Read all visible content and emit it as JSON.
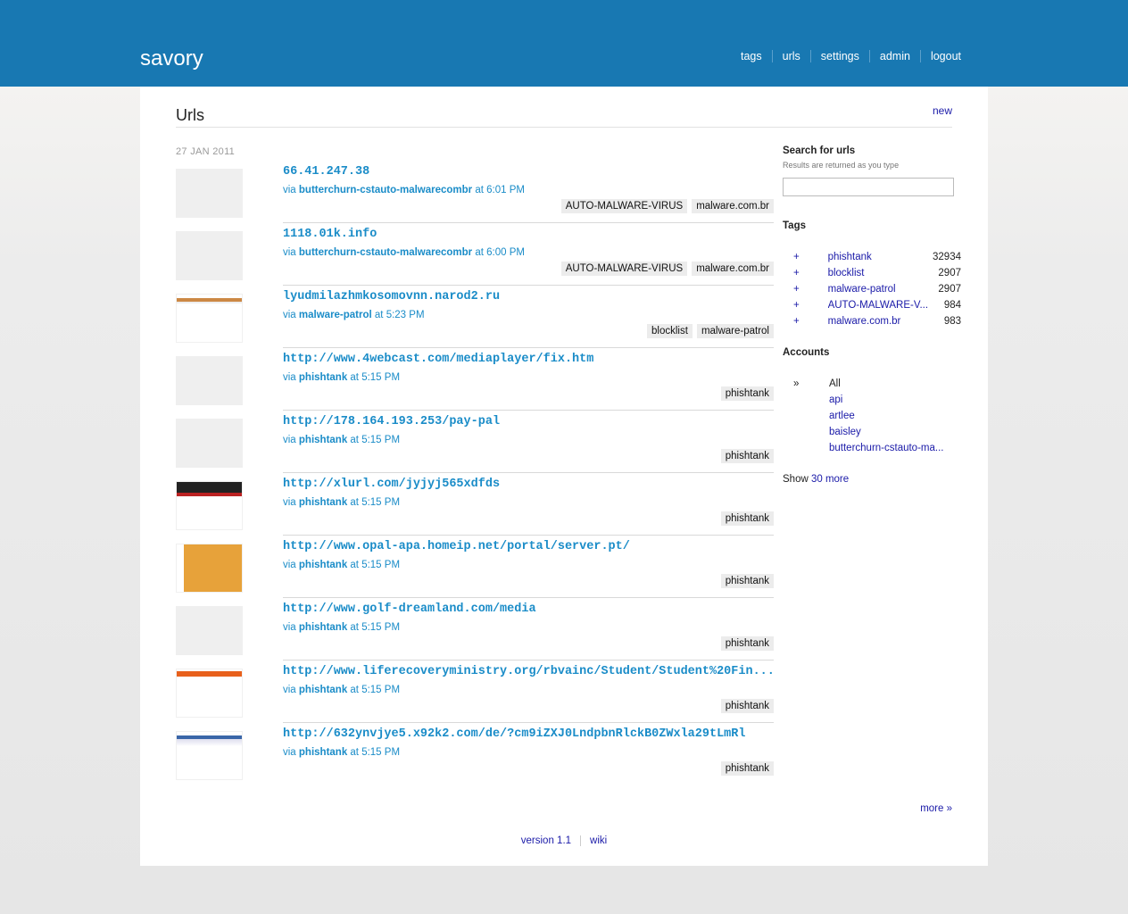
{
  "brand": "savory",
  "nav": [
    "tags",
    "urls",
    "settings",
    "admin",
    "logout"
  ],
  "page": {
    "title": "Urls",
    "new_label": "new",
    "date": "27 JAN 2011"
  },
  "entries": [
    {
      "url": "66.41.247.38",
      "via_prefix": "via ",
      "account": "butterchurn-cstauto-malwarecombr",
      "time": " at 6:01 PM",
      "tags": [
        "AUTO-MALWARE-VIRUS",
        "malware.com.br"
      ],
      "thumb": "blank"
    },
    {
      "url": "1118.01k.info",
      "via_prefix": "via ",
      "account": "butterchurn-cstauto-malwarecombr",
      "time": " at 6:00 PM",
      "tags": [
        "AUTO-MALWARE-VIRUS",
        "malware.com.br"
      ],
      "thumb": "blank"
    },
    {
      "url": "lyudmilazhmkosomovnn.narod2.ru",
      "via_prefix": "via ",
      "account": "malware-patrol",
      "time": " at 5:23 PM",
      "tags": [
        "blocklist",
        "malware-patrol"
      ],
      "thumb": "screenshot"
    },
    {
      "url": "http://www.4webcast.com/mediaplayer/fix.htm",
      "via_prefix": "via ",
      "account": "phishtank",
      "time": " at 5:15 PM",
      "tags": [
        "phishtank"
      ],
      "thumb": "blank"
    },
    {
      "url": "http://178.164.193.253/pay-pal",
      "via_prefix": "via ",
      "account": "phishtank",
      "time": " at 5:15 PM",
      "tags": [
        "phishtank"
      ],
      "thumb": "blank"
    },
    {
      "url": "http://xlurl.com/jyjyj565xdfds",
      "via_prefix": "via ",
      "account": "phishtank",
      "time": " at 5:15 PM",
      "tags": [
        "phishtank"
      ],
      "thumb": "screenshot"
    },
    {
      "url": "http://www.opal-apa.homeip.net/portal/server.pt/",
      "via_prefix": "via ",
      "account": "phishtank",
      "time": " at 5:15 PM",
      "tags": [
        "phishtank"
      ],
      "thumb": "screenshot"
    },
    {
      "url": "http://www.golf-dreamland.com/media",
      "via_prefix": "via ",
      "account": "phishtank",
      "time": " at 5:15 PM",
      "tags": [
        "phishtank"
      ],
      "thumb": "blank"
    },
    {
      "url": "http://www.liferecoveryministry.org/rbvainc/Student/Student%20Fin...",
      "via_prefix": "via ",
      "account": "phishtank",
      "time": " at 5:15 PM",
      "tags": [
        "phishtank"
      ],
      "thumb": "screenshot"
    },
    {
      "url": "http://632ynvjye5.x92k2.com/de/?cm9iZXJ0LndpbnRlckB0ZWxla29tLmRl",
      "via_prefix": "via ",
      "account": "phishtank",
      "time": " at 5:15 PM",
      "tags": [
        "phishtank"
      ],
      "thumb": "screenshot"
    }
  ],
  "sidebar": {
    "search_title": "Search for urls",
    "search_hint": "Results are returned as you type",
    "search_value": "",
    "tags_title": "Tags",
    "tags": [
      {
        "plus": "+",
        "name": "phishtank",
        "count": "32934"
      },
      {
        "plus": "+",
        "name": "blocklist",
        "count": "2907"
      },
      {
        "plus": "+",
        "name": "malware-patrol",
        "count": "2907"
      },
      {
        "plus": "+",
        "name": "AUTO-MALWARE-V...",
        "count": "984"
      },
      {
        "plus": "+",
        "name": "malware.com.br",
        "count": "983"
      }
    ],
    "accounts_title": "Accounts",
    "accounts": [
      {
        "mark": "»",
        "name": "All"
      },
      {
        "mark": "",
        "name": "api"
      },
      {
        "mark": "",
        "name": "artlee"
      },
      {
        "mark": "",
        "name": "baisley"
      },
      {
        "mark": "",
        "name": "butterchurn-cstauto-ma..."
      }
    ],
    "show_prefix": "Show ",
    "show_more": "30 more"
  },
  "more_label": "more »",
  "footer": {
    "version": "version 1.1",
    "wiki": "wiki"
  },
  "colors": {
    "header": "#1878b2",
    "link": "#1a8cc8",
    "nav_link": "#1a1aa8"
  }
}
